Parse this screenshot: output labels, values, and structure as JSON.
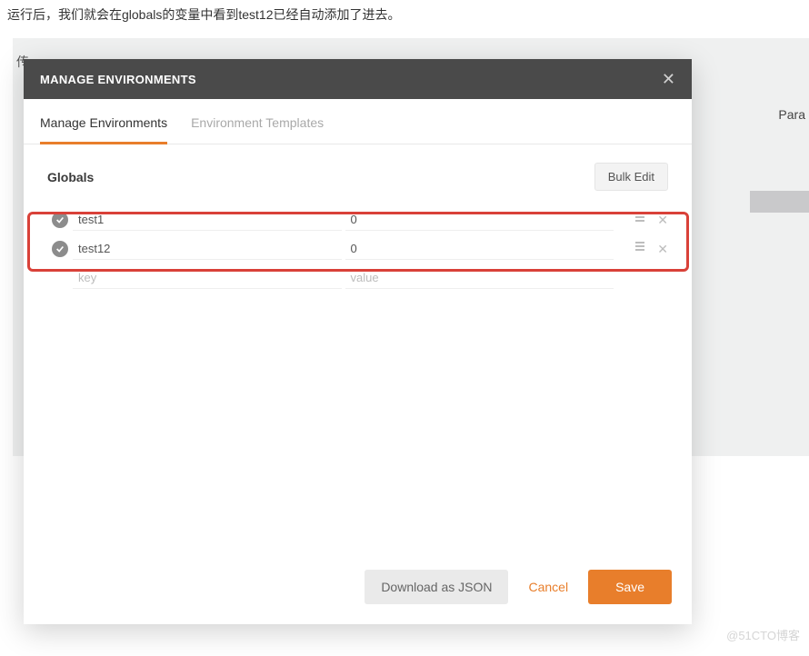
{
  "description": "运行后，我们就会在globals的变量中看到test12已经自动添加了进去。",
  "background": {
    "left_char": "传",
    "right_tab": "Para"
  },
  "modal": {
    "title": "MANAGE ENVIRONMENTS",
    "tabs": {
      "manage": "Manage Environments",
      "templates": "Environment Templates"
    },
    "globals": {
      "section_title": "Globals",
      "bulk_edit_label": "Bulk Edit",
      "rows": [
        {
          "key": "test1",
          "value": "0"
        },
        {
          "key": "test12",
          "value": "0"
        }
      ],
      "placeholder": {
        "key": "key",
        "value": "value"
      }
    },
    "footer": {
      "download_label": "Download as JSON",
      "cancel_label": "Cancel",
      "save_label": "Save"
    }
  },
  "watermark": "@51CTO博客"
}
